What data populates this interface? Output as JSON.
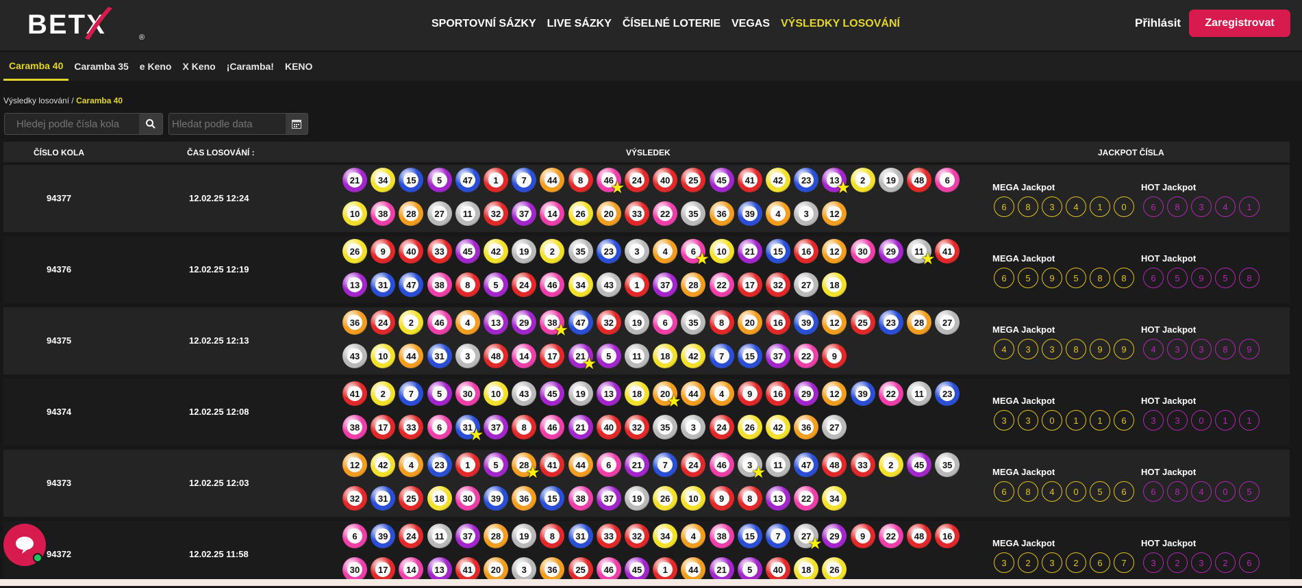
{
  "brand": {
    "logo_text": "BETX",
    "logo_mark": "®",
    "accent": "#e4d52a",
    "primary": "#d81b4e"
  },
  "nav": {
    "items": [
      "SPORTOVNÍ SÁZKY",
      "LIVE SÁZKY",
      "ČÍSELNÉ LOTERIE",
      "VEGAS",
      "VÝSLEDKY LOSOVÁNÍ"
    ],
    "active": 4
  },
  "auth": {
    "login": "Přihlásit",
    "register": "Zaregistrovat"
  },
  "tabs": {
    "items": [
      "Caramba 40",
      "Caramba 35",
      "e Keno",
      "X Keno",
      "¡Caramba!",
      "KENO"
    ],
    "active": 0
  },
  "breadcrumb": {
    "root": "Výsledky losování",
    "sep": " / ",
    "current": "Caramba 40"
  },
  "search": {
    "round_placeholder": "Hledej podle čísla kola",
    "date_placeholder": "Hledat podle data"
  },
  "table": {
    "headers": {
      "round": "ČÍSLO KOLA",
      "time": "ČAS LOSOVÁNÍ :",
      "result": "VÝSLEDEK",
      "jackpot": "JACKPOT ČÍSLA"
    },
    "mega_label": "MEGA Jackpot",
    "hot_label": "HOT Jackpot",
    "rows": [
      {
        "round": "94377",
        "time": "12.02.25 12:24",
        "balls": [
          21,
          34,
          15,
          5,
          47,
          1,
          7,
          44,
          8,
          46,
          24,
          40,
          25,
          45,
          41,
          42,
          23,
          13,
          2,
          19,
          48,
          6,
          10,
          38,
          28,
          27,
          11,
          32,
          37,
          14,
          26,
          20,
          33,
          22,
          35,
          36,
          39,
          4,
          3,
          12
        ],
        "stars": [
          9,
          17
        ],
        "mega": [
          "6",
          "8",
          "3",
          "4",
          "1",
          "0"
        ],
        "hot": [
          "6",
          "8",
          "3",
          "4",
          "1"
        ]
      },
      {
        "round": "94376",
        "time": "12.02.25 12:19",
        "balls": [
          26,
          9,
          40,
          33,
          45,
          42,
          19,
          2,
          35,
          23,
          3,
          4,
          6,
          10,
          21,
          15,
          16,
          12,
          30,
          29,
          11,
          41,
          13,
          31,
          47,
          38,
          8,
          5,
          24,
          46,
          34,
          43,
          1,
          37,
          28,
          22,
          17,
          32,
          27,
          18
        ],
        "stars": [
          12,
          20
        ],
        "mega": [
          "6",
          "5",
          "9",
          "5",
          "8",
          "8"
        ],
        "hot": [
          "6",
          "5",
          "9",
          "5",
          "8"
        ]
      },
      {
        "round": "94375",
        "time": "12.02.25 12:13",
        "balls": [
          36,
          24,
          2,
          46,
          4,
          13,
          29,
          38,
          47,
          32,
          19,
          6,
          35,
          8,
          20,
          16,
          39,
          12,
          25,
          23,
          28,
          27,
          43,
          10,
          44,
          31,
          3,
          48,
          14,
          17,
          21,
          5,
          11,
          18,
          42,
          7,
          15,
          37,
          22,
          9
        ],
        "stars": [
          7,
          30
        ],
        "mega": [
          "4",
          "3",
          "3",
          "8",
          "9",
          "9"
        ],
        "hot": [
          "4",
          "3",
          "3",
          "8",
          "9"
        ]
      },
      {
        "round": "94374",
        "time": "12.02.25 12:08",
        "balls": [
          41,
          2,
          7,
          5,
          30,
          10,
          43,
          45,
          19,
          13,
          18,
          20,
          44,
          4,
          9,
          16,
          29,
          12,
          39,
          22,
          11,
          23,
          38,
          17,
          33,
          6,
          31,
          37,
          8,
          46,
          21,
          40,
          32,
          35,
          3,
          24,
          26,
          42,
          36,
          27
        ],
        "stars": [
          11,
          26
        ],
        "mega": [
          "3",
          "3",
          "0",
          "1",
          "1",
          "6"
        ],
        "hot": [
          "3",
          "3",
          "0",
          "1",
          "1"
        ]
      },
      {
        "round": "94373",
        "time": "12.02.25 12:03",
        "balls": [
          12,
          42,
          4,
          23,
          1,
          5,
          28,
          41,
          44,
          6,
          21,
          7,
          24,
          46,
          3,
          11,
          47,
          48,
          33,
          2,
          45,
          35,
          32,
          31,
          25,
          18,
          30,
          39,
          36,
          15,
          38,
          37,
          19,
          26,
          10,
          9,
          8,
          13,
          22,
          34
        ],
        "stars": [
          6,
          14
        ],
        "mega": [
          "6",
          "8",
          "4",
          "0",
          "5",
          "6"
        ],
        "hot": [
          "6",
          "8",
          "4",
          "0",
          "5"
        ]
      },
      {
        "round": "94372",
        "time": "12.02.25 11:58",
        "balls": [
          6,
          39,
          24,
          11,
          37,
          28,
          19,
          8,
          31,
          33,
          32,
          34,
          4,
          38,
          15,
          7,
          27,
          29,
          9,
          22,
          48,
          16,
          30,
          17,
          14,
          13,
          41,
          20,
          3,
          36,
          25,
          46,
          45,
          1,
          44,
          21,
          5,
          40,
          18,
          26
        ],
        "stars": [
          16
        ],
        "mega": [
          "3",
          "2",
          "3",
          "2",
          "6",
          "7"
        ],
        "hot": [
          "3",
          "2",
          "3",
          "2",
          "6"
        ]
      }
    ]
  },
  "ball_colors": {
    "1": "#e22828",
    "2": "#f3e02a",
    "3": "#b9b9b9",
    "4": "#f29d20",
    "5": "#a326cc",
    "6": "#ee3fa9",
    "7": "#2a4fd6",
    "8": "#25a93a",
    "0": "#e22828"
  },
  "chat": {
    "icon": "chat-bubble-icon"
  }
}
